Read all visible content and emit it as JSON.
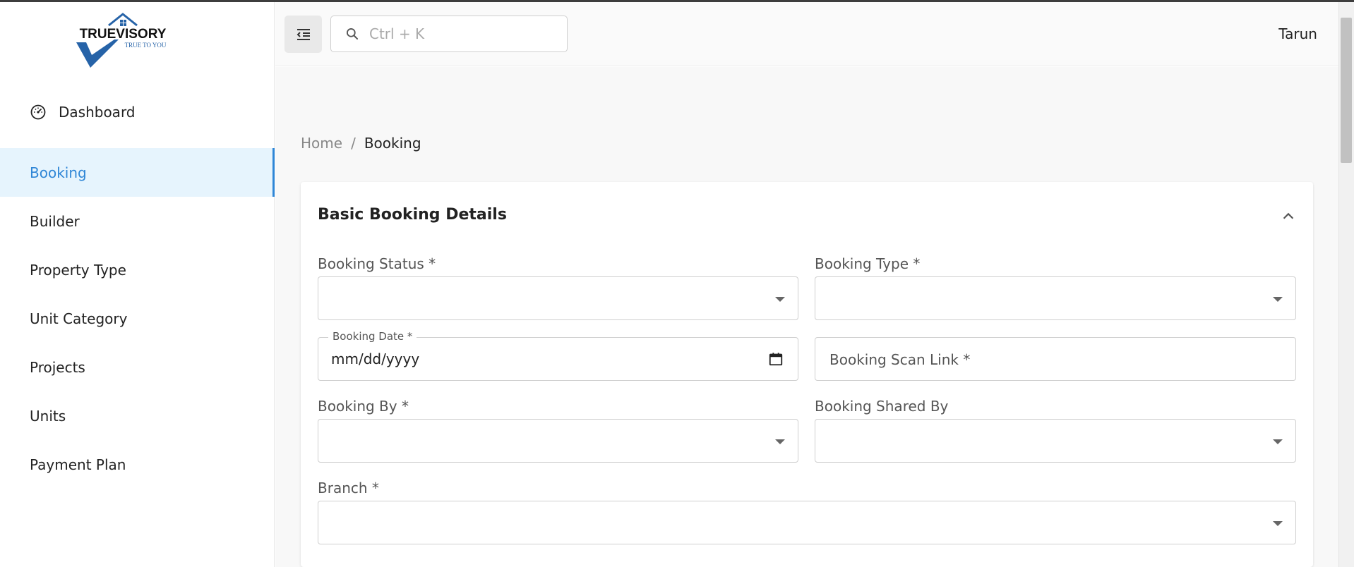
{
  "brand": {
    "name": "TRUEVISORY",
    "tagline": "TRUE TO YOU"
  },
  "sidebar": {
    "dashboard_label": "Dashboard",
    "items": [
      {
        "label": "Booking",
        "active": true
      },
      {
        "label": "Builder"
      },
      {
        "label": "Property Type"
      },
      {
        "label": "Unit Category"
      },
      {
        "label": "Projects"
      },
      {
        "label": "Units"
      },
      {
        "label": "Payment Plan"
      }
    ]
  },
  "header": {
    "search_placeholder": "Ctrl + K",
    "user_name": "Tarun"
  },
  "breadcrumb": {
    "home": "Home",
    "separator": "/",
    "current": "Booking"
  },
  "form": {
    "title": "Basic Booking Details",
    "booking_status_label": "Booking Status *",
    "booking_type_label": "Booking Type *",
    "booking_date_label": "Booking Date *",
    "booking_date_value": "mm/dd/yyyy",
    "booking_scan_link_placeholder": "Booking Scan Link *",
    "booking_by_label": "Booking By *",
    "booking_shared_by_label": "Booking Shared By",
    "branch_label": "Branch *"
  },
  "icons": {
    "dashboard": "gauge-icon",
    "menu": "menu-collapse-icon",
    "search": "search-icon",
    "collapse": "chevron-up-icon",
    "calendar": "calendar-icon",
    "dropdown": "caret-down-icon"
  },
  "colors": {
    "accent": "#2f86d6",
    "active_bg": "#e6f4fd",
    "logo_blue": "#2663a8"
  }
}
